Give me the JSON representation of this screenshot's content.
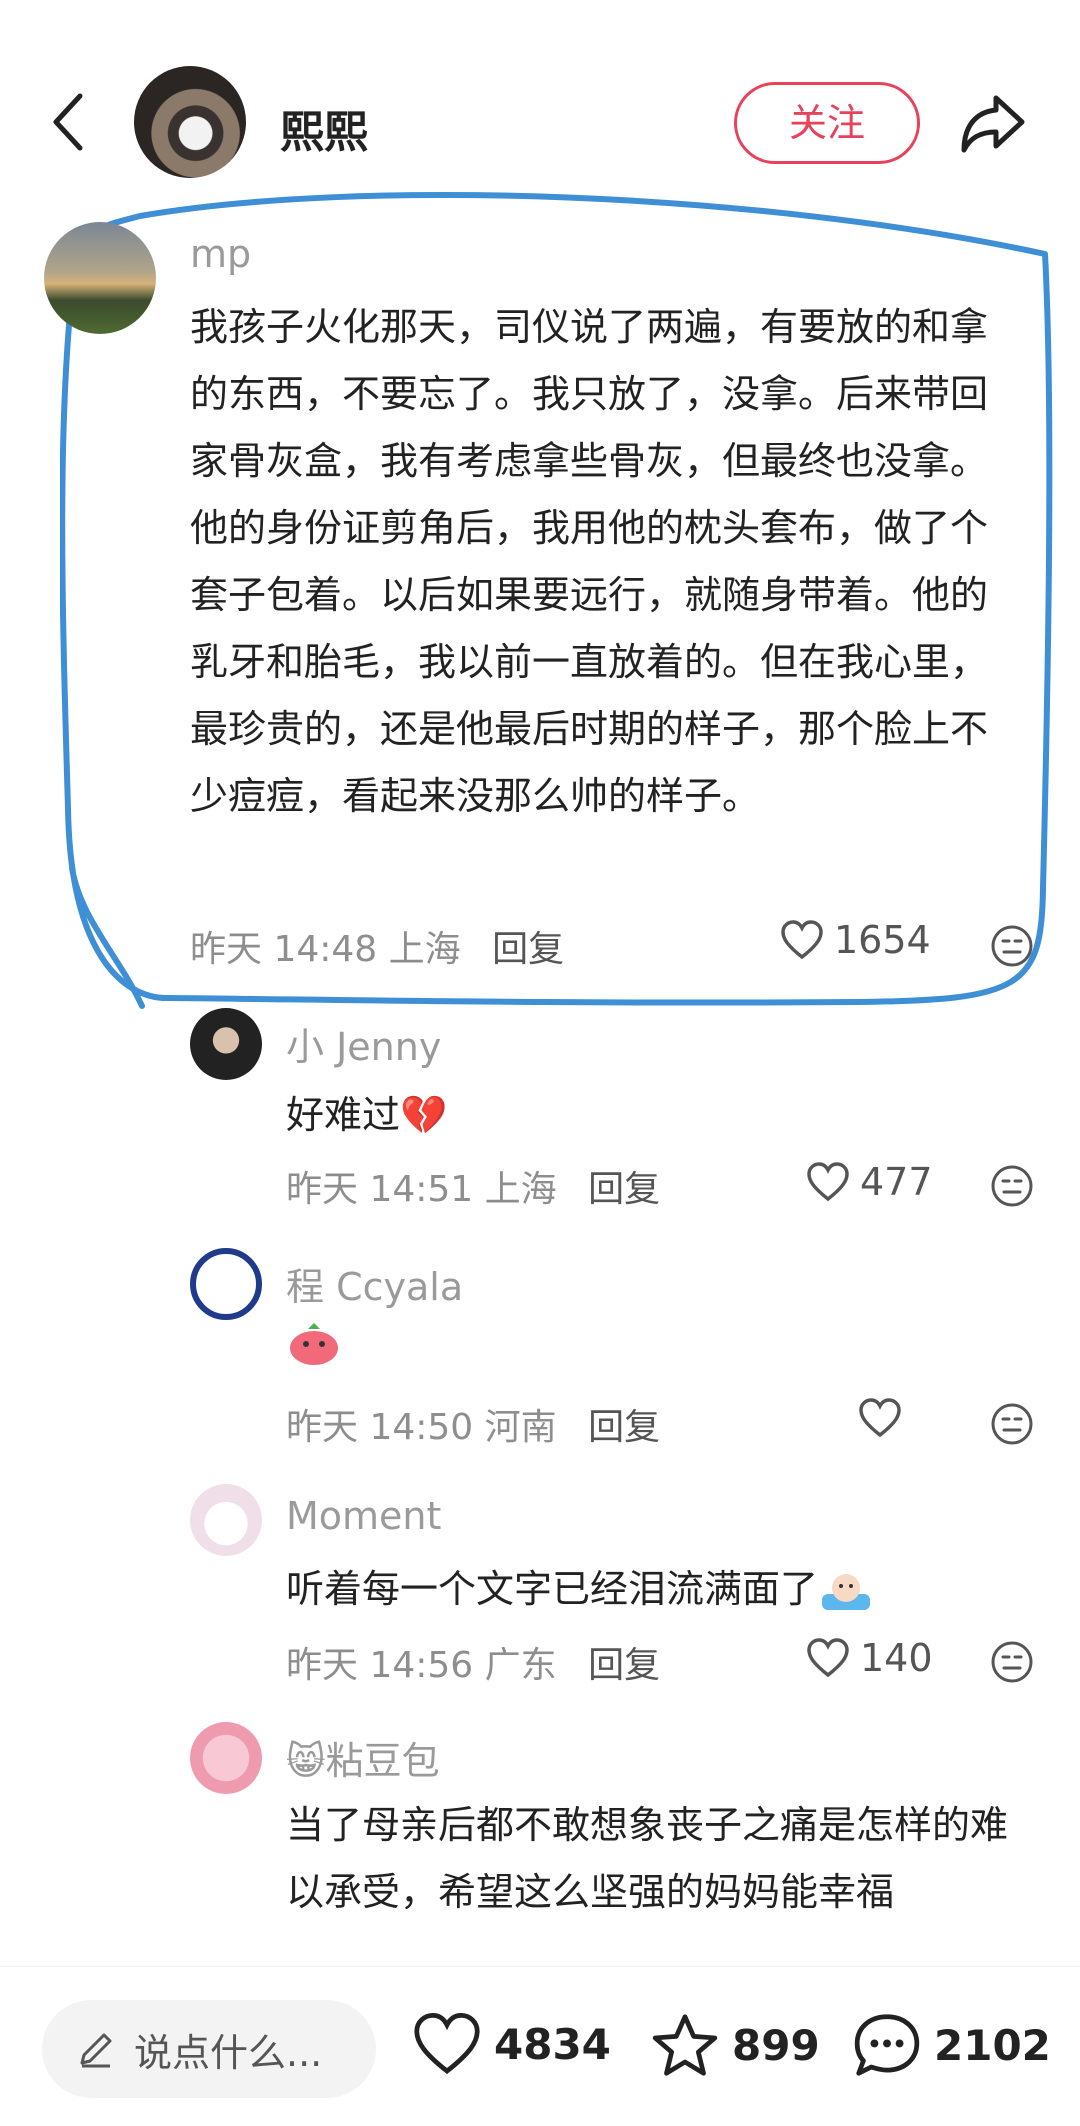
{
  "header": {
    "user_name": "熙熙",
    "follow_label": "关注"
  },
  "comments": [
    {
      "user": "mp",
      "text": "我孩子火化那天，司仪说了两遍，有要放的和拿的东西，不要忘了。我只放了，没拿。后来带回家骨灰盒，我有考虑拿些骨灰，但最终也没拿。他的身份证剪角后，我用他的枕头套布，做了个套子包着。以后如果要远行，就随身带着。他的乳牙和胎毛，我以前一直放着的。但在我心里，最珍贵的，还是他最后时期的样子，那个脸上不少痘痘，看起来没那么帅的样子。",
      "time": "昨天 14:48",
      "location": "上海",
      "reply_label": "回复",
      "likes": "1654"
    },
    {
      "user": "小 Jenny",
      "text": "好难过",
      "emoji": "💔",
      "time": "昨天 14:51",
      "location": "上海",
      "reply_label": "回复",
      "likes": "477"
    },
    {
      "user": "程 Ccyala",
      "text": "",
      "emoji": "sticker-pink-face",
      "time": "昨天 14:50",
      "location": "河南",
      "reply_label": "回复",
      "likes": ""
    },
    {
      "user": "Moment",
      "text": "听着每一个文字已经泪流满面了",
      "emoji": "crying-sticker",
      "time": "昨天 14:56",
      "location": "广东",
      "reply_label": "回复",
      "likes": "140"
    },
    {
      "user": "粘豆包",
      "user_emoji": "😸",
      "text": "当了母亲后都不敢想象丧子之痛是怎样的难以承受，希望这么坚强的妈妈能幸福"
    }
  ],
  "bottom_bar": {
    "input_placeholder": "说点什么...",
    "likes_count": "4834",
    "favorites_count": "899",
    "comments_count": "2102"
  },
  "colors": {
    "accent": "#e8415a",
    "highlight_stroke": "#3f8fd6",
    "meta_text": "#8e8e8e"
  }
}
